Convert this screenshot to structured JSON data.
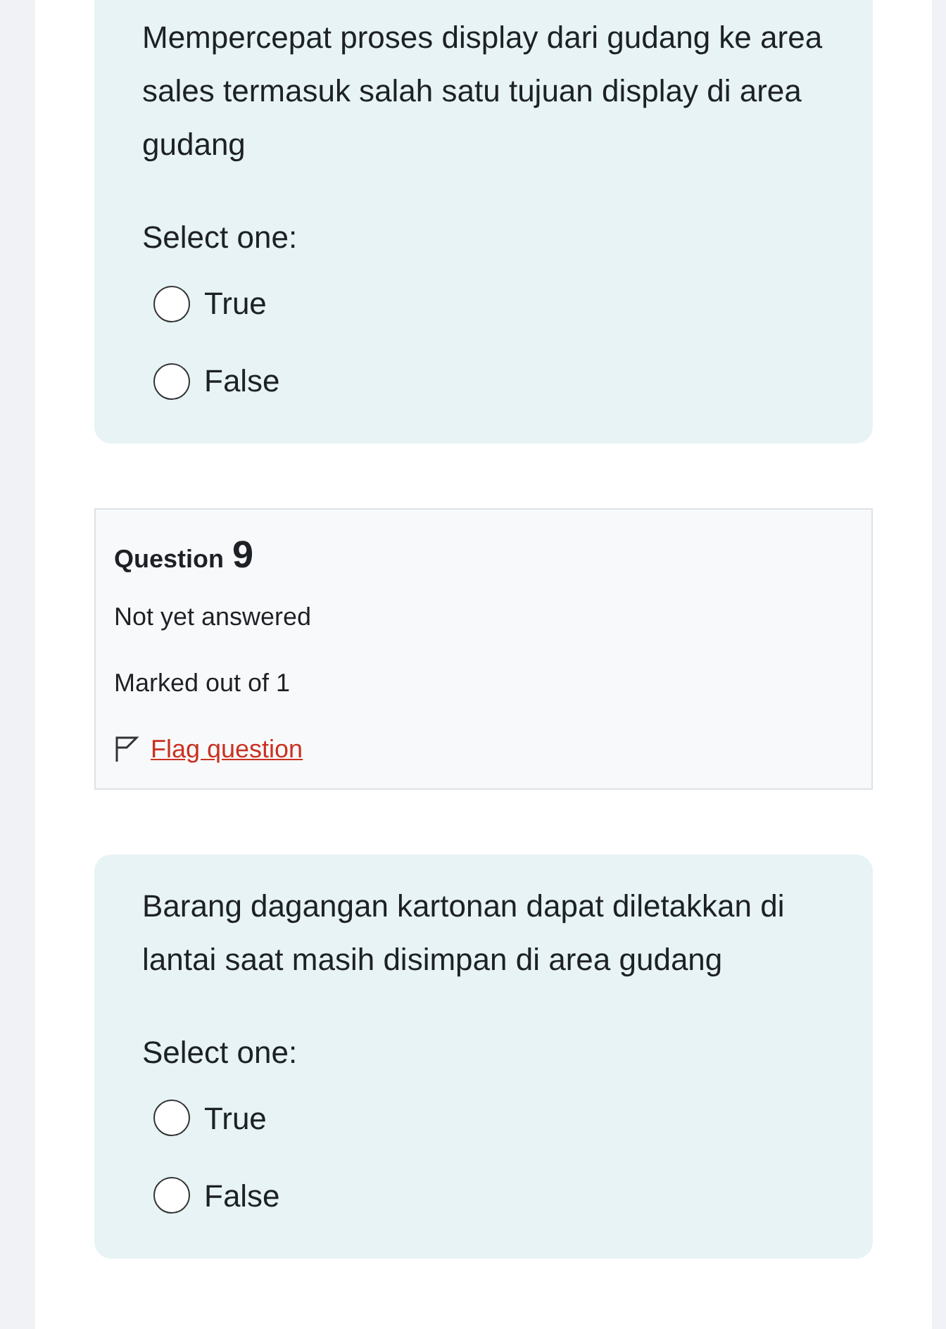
{
  "questions": [
    {
      "kind": "partial",
      "text": "Mempercepat proses display dari gudang ke area sales termasuk salah satu tujuan display di area gudang",
      "prompt": "Select one:",
      "options": [
        {
          "label": "True",
          "selected": false
        },
        {
          "label": "False",
          "selected": false
        }
      ]
    },
    {
      "kind": "full",
      "info": {
        "label": "Question",
        "number": "9",
        "status": "Not yet answered",
        "marks": "Marked out of 1",
        "flag": {
          "label": "Flag question",
          "flagged": false
        }
      },
      "text": "Barang dagangan kartonan dapat diletakkan di lantai saat masih disimpan di area gudang",
      "prompt": "Select one:",
      "options": [
        {
          "label": "True",
          "selected": false
        },
        {
          "label": "False",
          "selected": false
        }
      ]
    }
  ]
}
